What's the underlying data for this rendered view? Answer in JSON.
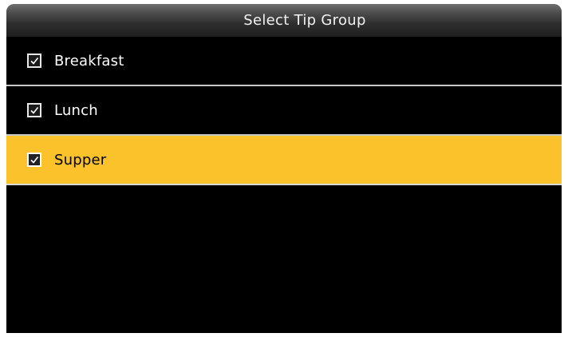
{
  "header": {
    "title": "Select Tip Group"
  },
  "list": {
    "items": [
      {
        "label": "Breakfast",
        "checked": true,
        "selected": false
      },
      {
        "label": "Lunch",
        "checked": true,
        "selected": false
      },
      {
        "label": "Supper",
        "checked": true,
        "selected": true
      }
    ]
  },
  "colors": {
    "highlight": "#fcc22b",
    "background": "#000000",
    "text": "#ffffff",
    "divider": "#c8c8c8"
  },
  "icons": {
    "checkbox": "check-icon"
  }
}
